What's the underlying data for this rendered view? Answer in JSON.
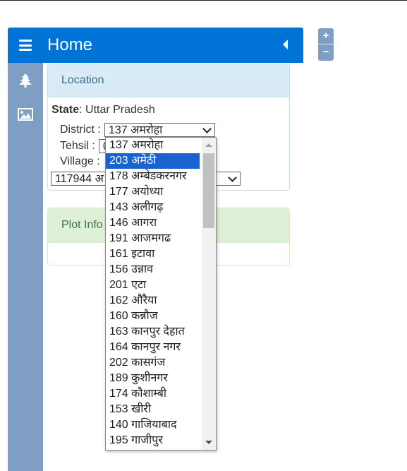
{
  "header": {
    "title": "Home"
  },
  "sidebar": {
    "icons": [
      "tree-icon",
      "image-icon"
    ]
  },
  "map_controls": {
    "zoom_in": "+",
    "zoom_out": "−"
  },
  "location_panel": {
    "title": "Location",
    "state_label": "State",
    "state_value": ": Uttar Pradesh",
    "district_label": "District :",
    "district_value": "137 अमरोहा",
    "tehsil_label": "Tehsil :",
    "tehsil_value": "0",
    "village_label": "Village :",
    "village_value": "117944 अ"
  },
  "plot_panel": {
    "title": "Plot Info"
  },
  "district_dropdown": {
    "selected_index": 1,
    "options": [
      "137 अमरोहा",
      "203 अमेठी",
      "178 अम्बेडकरनगर",
      "177 अयोध्या",
      "143 अलीगढ़",
      "146 आगरा",
      "191 आजमगढ",
      "161 इटावा",
      "156 उन्नाव",
      "201 एटा",
      "162 औरैया",
      "160 कन्नौज",
      "163 कानपुर देहात",
      "164 कानपुर नगर",
      "202 कासगंज",
      "189 कुशीनगर",
      "174 कौशाम्बी",
      "153 खीरी",
      "140 गाजियाबाद",
      "195 गाजीपुर"
    ]
  }
}
